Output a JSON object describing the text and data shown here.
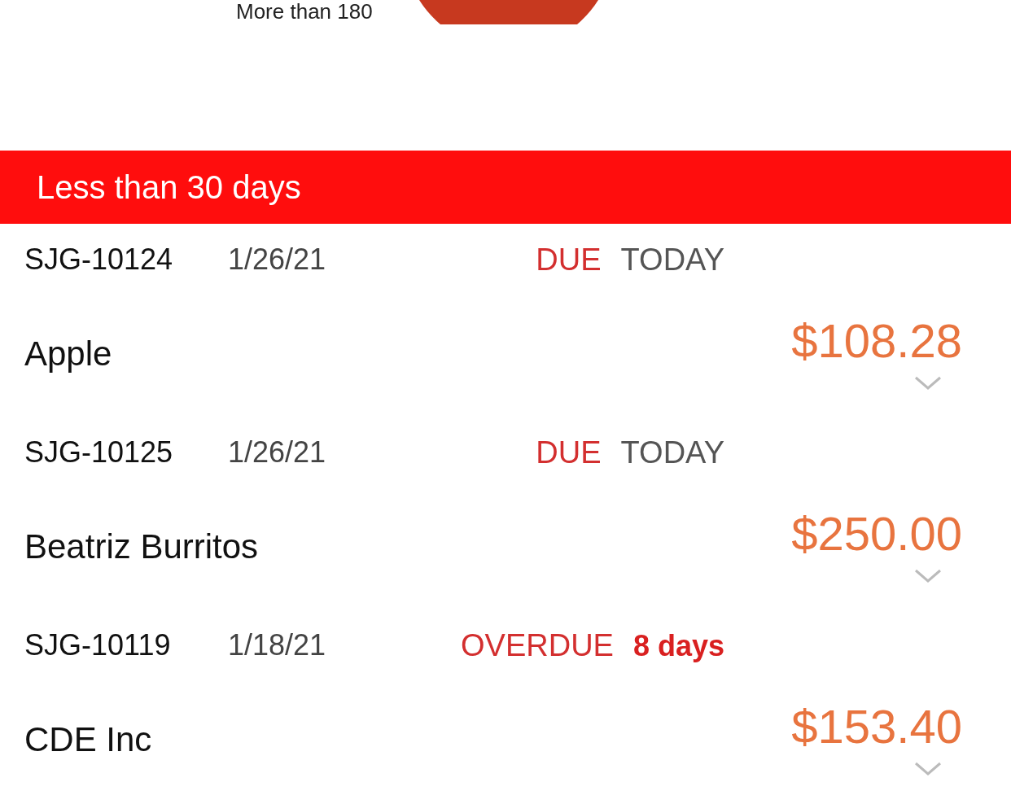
{
  "legend": {
    "label": "More than 180"
  },
  "section": {
    "title": "Less than 30 days"
  },
  "invoices": [
    {
      "number": "SJG-10124",
      "date": "1/26/21",
      "status": "DUE",
      "detail": "TODAY",
      "kind": "due",
      "customer": "Apple",
      "amount": "$108.28"
    },
    {
      "number": "SJG-10125",
      "date": "1/26/21",
      "status": "DUE",
      "detail": "TODAY",
      "kind": "due",
      "customer": "Beatriz Burritos",
      "amount": "$250.00"
    },
    {
      "number": "SJG-10119",
      "date": "1/18/21",
      "status": "OVERDUE",
      "detail": "8 days",
      "kind": "overdue",
      "customer": "CDE Inc",
      "amount": "$153.40"
    }
  ]
}
